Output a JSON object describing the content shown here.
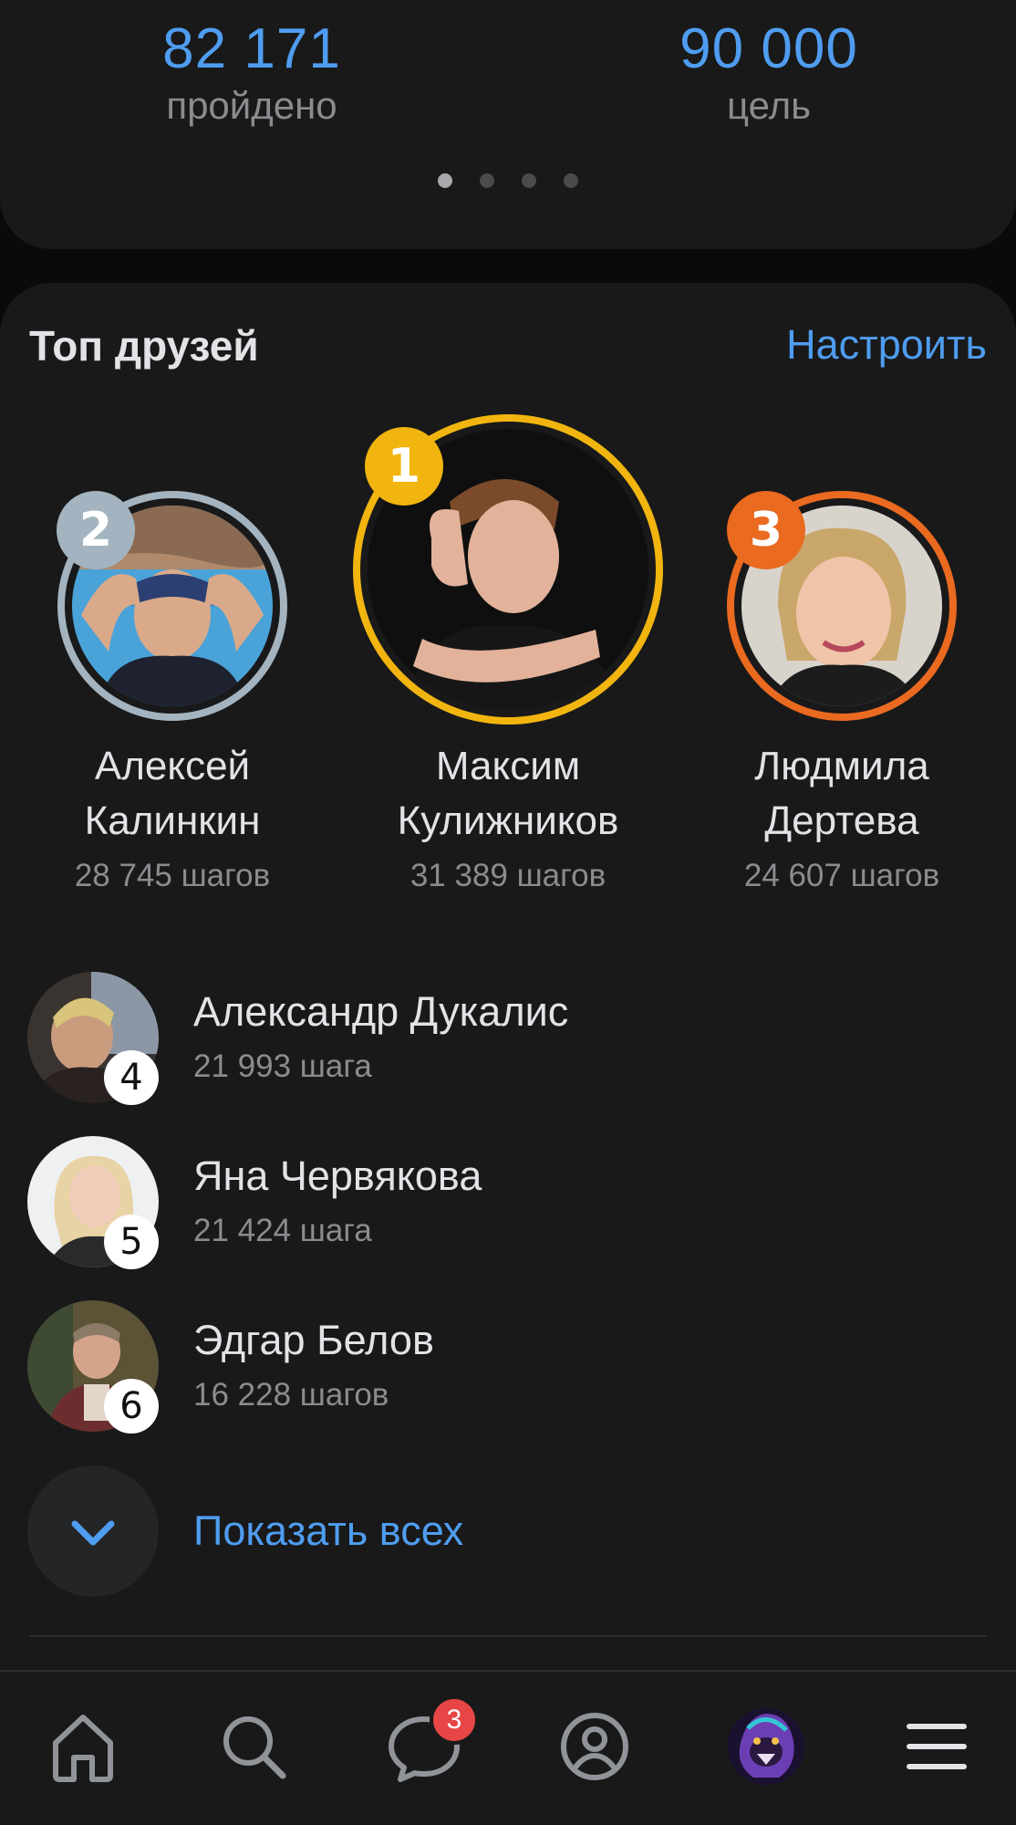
{
  "progress": {
    "done_value": "82 171",
    "done_label": "пройдено",
    "goal_value": "90 000",
    "goal_label": "цель",
    "pages_total": 4,
    "page_active": 1
  },
  "top_friends": {
    "title": "Топ друзей",
    "configure": "Настроить",
    "podium": [
      {
        "rank": "2",
        "first": "Алексей",
        "last": "Калинкин",
        "steps": "28 745 шагов",
        "ring_color": "#a3b4c0"
      },
      {
        "rank": "1",
        "first": "Максим",
        "last": "Кулижников",
        "steps": "31 389 шагов",
        "ring_color": "#f2b50f"
      },
      {
        "rank": "3",
        "first": "Людмила",
        "last": "Дертева",
        "steps": "24 607 шагов",
        "ring_color": "#ea6a20"
      }
    ],
    "list": [
      {
        "rank": "4",
        "name": "Александр Дукалис",
        "steps": "21 993 шага"
      },
      {
        "rank": "5",
        "name": "Яна Червякова",
        "steps": "21 424 шага"
      },
      {
        "rank": "6",
        "name": "Эдгар Белов",
        "steps": "16 228 шагов"
      }
    ],
    "show_all": "Показать всех"
  },
  "tabbar": {
    "messages_badge": "3",
    "icons": [
      "home-icon",
      "search-icon",
      "messages-icon",
      "profile-icon",
      "services-avatar",
      "menu-icon"
    ]
  },
  "colors": {
    "accent": "#4f9df0",
    "background": "#0a0a0a",
    "card": "#19191a",
    "badge_red": "#e64646"
  }
}
